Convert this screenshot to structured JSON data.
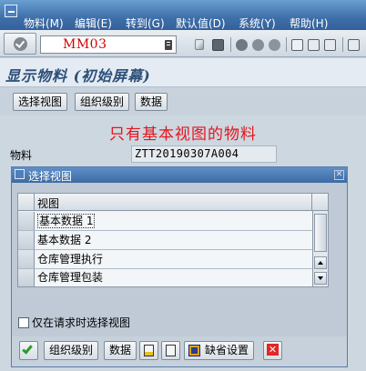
{
  "menubar": {
    "items": [
      {
        "label": "物料(M)"
      },
      {
        "label": "编辑(E)"
      },
      {
        "label": "转到(G)"
      },
      {
        "label": "默认值(D)"
      },
      {
        "label": "系统(Y)"
      },
      {
        "label": "帮助(H)"
      }
    ]
  },
  "toolbar": {
    "command_value": "MM03"
  },
  "title_bar": {
    "title": "显示物料 (初始屏幕)"
  },
  "app_toolbar": {
    "select_views_label": "选择视图",
    "org_levels_label": "组织级别",
    "data_label": "数据"
  },
  "main": {
    "heading": "只有基本视图的物料",
    "material_label": "物料",
    "material_value": "ZTT20190307A004"
  },
  "dialog": {
    "title": "选择视图",
    "table": {
      "column_header": "视图",
      "rows": [
        {
          "label": "基本数据 1"
        },
        {
          "label": "基本数据 2"
        },
        {
          "label": "仓库管理执行"
        },
        {
          "label": "仓库管理包装"
        }
      ]
    },
    "only_on_request_label": "仅在请求时选择视图",
    "footer": {
      "org_levels_label": "组织级别",
      "data_label": "数据",
      "default_label": "缺省设置"
    }
  },
  "colors": {
    "menubar": "#3e6fa8",
    "heading_red": "#e8131b",
    "command_red": "#d40000",
    "title_blue": "#2d4f78"
  }
}
